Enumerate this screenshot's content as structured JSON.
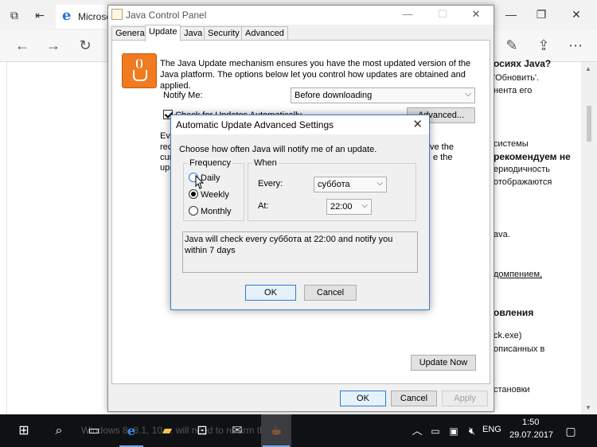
{
  "browser": {
    "tab_title": "Microsc",
    "right_title_icons": [
      "minimize-icon",
      "restore-icon",
      "close-icon"
    ],
    "nav_icons": [
      "back-arrow-icon",
      "forward-arrow-icon",
      "refresh-icon"
    ],
    "toolbar_icons": [
      "pen-icon",
      "share-icon"
    ],
    "article_lines": [
      {
        "text": "осиях Java?",
        "style": "bold"
      },
      {
        "text": "'Обновить'.",
        "style": "normal"
      },
      {
        "text": "нента его",
        "style": "normal"
      },
      {
        "text": "системы",
        "style": "normal"
      },
      {
        "text": "рекомендуем не",
        "style": "bold"
      },
      {
        "text": "ериодичность",
        "style": "normal"
      },
      {
        "text": "отображаются",
        "style": "normal"
      },
      {
        "text": "ava.",
        "style": "normal"
      },
      {
        "text": "домпением,",
        "style": "link"
      },
      {
        "text": "овления",
        "style": "bold"
      },
      {
        "text": "ck.exe)",
        "style": "normal"
      },
      {
        "text": "описанных в",
        "style": "normal"
      },
      {
        "text": "",
        "style": "normal"
      },
      {
        "text": "становки",
        "style": "normal"
      }
    ]
  },
  "java_panel": {
    "title": "Java Control Panel",
    "tabs": [
      "General",
      "Update",
      "Java",
      "Security",
      "Advanced"
    ],
    "active_tab": "Update",
    "intro": "The Java Update mechanism ensures you have the most updated version of the Java platform. The options below let you control how updates are obtained and applied.",
    "notify_label": "Notify Me:",
    "notify_value": "Before downloading",
    "check_label": "Check for Updates Automatically",
    "advanced_button": "Advanced...",
    "hidden_fragments": [
      "Eve",
      "rec",
      "cur",
      "upd"
    ],
    "hidden_fragments_right": [
      "ve the",
      "e the"
    ],
    "update_now_button": "Update Now",
    "ok_button": "OK",
    "cancel_button": "Cancel",
    "apply_button": "Apply"
  },
  "advanced_dialog": {
    "title": "Automatic Update Advanced Settings",
    "prompt": "Choose how often Java will notify me of an update.",
    "frequency_title": "Frequency",
    "frequency_options": [
      "Daily",
      "Weekly",
      "Monthly"
    ],
    "selected_frequency": "Weekly",
    "when_title": "When",
    "every_label": "Every:",
    "every_value": "суббота",
    "at_label": "At:",
    "at_value": "22:00",
    "message": "Java will check every суббота at 22:00 and notify you within 7 days",
    "ok_button": "OK",
    "cancel_button": "Cancel"
  },
  "taskbar": {
    "ghost_text": "Windows 8, 8.1, 10 ... will need to re-arm the trial.",
    "language": "ENG",
    "time": "1:50",
    "date": "29.07.2017"
  }
}
